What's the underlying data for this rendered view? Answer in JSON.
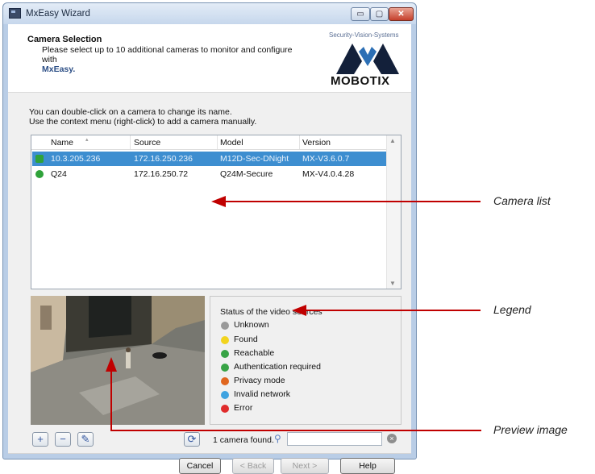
{
  "window": {
    "title": "MxEasy Wizard",
    "min_glyph": "▭",
    "max_glyph": "▢",
    "close_glyph": "✕"
  },
  "header": {
    "title": "Camera Selection",
    "description_line1": "Please select up to 10 additional cameras to monitor and configure with",
    "brand_name": "MxEasy.",
    "logo_tagline": "Security-Vision-Systems",
    "logo_text": "MOBOTIX"
  },
  "intro": {
    "line1": "You can double-click on a camera to change its name.",
    "line2": "Use the context menu (right-click) to add a camera manually."
  },
  "camera_list": {
    "columns": [
      "Name",
      "Source",
      "Model",
      "Version"
    ],
    "rows": [
      {
        "name": "10.3.205.236",
        "source": "172.16.250.236",
        "model": "M12D-Sec-DNight",
        "version": "MX-V3.6.0.7",
        "status_color": "#2fa23a",
        "selected": true
      },
      {
        "name": "Q24",
        "source": "172.16.250.72",
        "model": "Q24M-Secure",
        "version": "MX-V4.0.4.28",
        "status_color": "#2fa23a",
        "selected": false
      }
    ]
  },
  "legend": {
    "title": "Status of the video sources",
    "items": [
      {
        "label": "Unknown",
        "color": "#9a9a9a"
      },
      {
        "label": "Found",
        "color": "#f2d41e"
      },
      {
        "label": "Reachable",
        "color": "#37a345"
      },
      {
        "label": "Authentication required",
        "color": "#37a345",
        "icon": "lock-icon"
      },
      {
        "label": "Privacy mode",
        "color": "#e0661f",
        "icon": "lock-icon"
      },
      {
        "label": "Invalid network",
        "color": "#3fa3e0"
      },
      {
        "label": "Error",
        "color": "#e02c2c"
      }
    ]
  },
  "toolbar": {
    "add_glyph": "+",
    "remove_glyph": "−",
    "edit_glyph": "✎",
    "search_camera_glyph": "⟳",
    "found_text": "1 camera  found.",
    "search_value": "",
    "clear_glyph": "×"
  },
  "buttons": {
    "cancel": "Cancel",
    "back": "< Back",
    "next": "Next >",
    "help": "Help"
  },
  "annotations": {
    "camera_list": "Camera list",
    "legend": "Legend",
    "preview": "Preview image"
  },
  "colors": {
    "selection": "#3d8ed0",
    "arrow": "#c00000"
  }
}
